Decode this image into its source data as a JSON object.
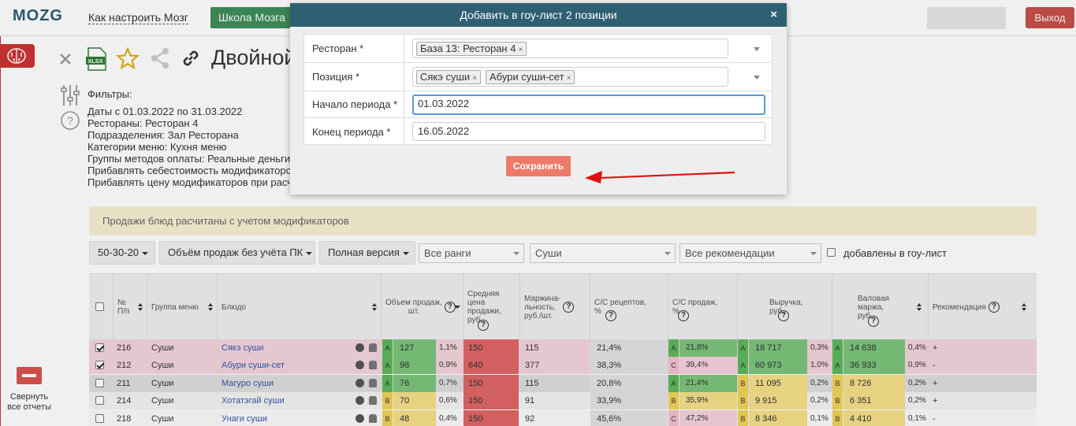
{
  "header": {
    "logo": "MOZG",
    "nav_link": "Как настроить Мозг",
    "school_button": "Школа Мозга",
    "logout": "Выход"
  },
  "sidebar": {
    "collapse_label_1": "Свернуть",
    "collapse_label_2": "все отчеты"
  },
  "toolbar_icons": [
    "close-icon",
    "xlsx-icon",
    "star-icon",
    "share-icon",
    "link-icon"
  ],
  "page_title": "Двойной",
  "filters": {
    "title": "Фильтры:",
    "lines": [
      "Даты с 01.03.2022 по 31.03.2022",
      "Рестораны: Ресторан 4",
      "Подразделения: Зал Ресторана",
      "Категории меню: Кухня меню",
      "Группы методов оплаты: Реальные деньги",
      "Прибавлять себестоимость модификаторов",
      "Прибавлять цену модификаторов при расчёте"
    ]
  },
  "notice": "Продажи блюд расчитаны с учетом модификаторов",
  "filter_bar": {
    "btn_abc": "50-30-20",
    "btn_volume": "Объём продаж без учёта ПК",
    "btn_version": "Полная версия",
    "select_ranks": "Все ранги",
    "select_group": "Суши",
    "select_recs": "Все рекомендации",
    "checkbox_label": "добавлены в гоу-лист"
  },
  "table": {
    "headers": {
      "num": "№\nП/п",
      "group": "Группа меню",
      "dish": "Блюдо",
      "volume": "Объем продаж,\nшт.",
      "avg_price": "Средняя\nцена\nпродажи,\nруб.",
      "margin": "Маржина-\nльность,\nруб./шт.",
      "cs_recipes": "С/С рецептов,\n%",
      "cs_sales": "С/С продаж,\n%",
      "revenue": "Выручка,\nруб.",
      "gross": "Валовая\nмаржа,\nруб.",
      "recommendation": "Рекомендация"
    },
    "rows": [
      {
        "checked": true,
        "num": "216",
        "group": "Суши",
        "dish": "Сякэ суши",
        "vol_rank": "A",
        "vol": "127",
        "vol_pct": "1,1%",
        "price": "150",
        "margin": "115",
        "csr": "21,4%",
        "css_rank": "A",
        "css": "21,8%",
        "rev_rank": "A",
        "rev": "18 717",
        "rev_pct": "0,3%",
        "gm_rank": "A",
        "gm": "14 638",
        "gm_pct": "0,4%",
        "rec": "+"
      },
      {
        "checked": true,
        "num": "212",
        "group": "Суши",
        "dish": "Абури суши-сет",
        "vol_rank": "A",
        "vol": "98",
        "vol_pct": "0,9%",
        "price": "640",
        "margin": "377",
        "csr": "38,3%",
        "css_rank": "C",
        "css": "39,4%",
        "rev_rank": "A",
        "rev": "60 973",
        "rev_pct": "1,0%",
        "gm_rank": "A",
        "gm": "36 933",
        "gm_pct": "0,9%",
        "rec": "-"
      },
      {
        "checked": false,
        "num": "211",
        "group": "Суши",
        "dish": "Магуро суши",
        "vol_rank": "A",
        "vol": "76",
        "vol_pct": "0,7%",
        "price": "150",
        "margin": "115",
        "csr": "20,8%",
        "css_rank": "A",
        "css": "21,4%",
        "rev_rank": "B",
        "rev": "11 095",
        "rev_pct": "0,2%",
        "gm_rank": "B",
        "gm": "8 726",
        "gm_pct": "0,2%",
        "rec": "+"
      },
      {
        "checked": false,
        "num": "214",
        "group": "Суши",
        "dish": "Хотатэгай суши",
        "vol_rank": "B",
        "vol": "70",
        "vol_pct": "0,6%",
        "price": "150",
        "margin": "91",
        "csr": "33,9%",
        "css_rank": "B",
        "css": "35,9%",
        "rev_rank": "B",
        "rev": "9 915",
        "rev_pct": "0,2%",
        "gm_rank": "B",
        "gm": "6 351",
        "gm_pct": "0,2%",
        "rec": "+"
      },
      {
        "checked": false,
        "num": "218",
        "group": "Суши",
        "dish": "Унаги суши",
        "vol_rank": "B",
        "vol": "48",
        "vol_pct": "0,4%",
        "price": "150",
        "margin": "92",
        "csr": "45,6%",
        "css_rank": "C",
        "css": "47,2%",
        "rev_rank": "B",
        "rev": "8 346",
        "rev_pct": "0,1%",
        "gm_rank": "B",
        "gm": "4 410",
        "gm_pct": "0,1%",
        "rec": "-"
      }
    ]
  },
  "modal": {
    "title": "Добавить в гоу-лист 2 позиции",
    "close": "×",
    "restaurant_label": "Ресторан *",
    "restaurant_tags": [
      "База 13: Ресторан 4"
    ],
    "position_label": "Позиция *",
    "position_tags": [
      "Сякэ суши",
      "Абури суши-сет"
    ],
    "tag_remove": "×",
    "start_label": "Начало периода *",
    "start_value": "01.03.2022",
    "end_label": "Конец периода *",
    "end_value": "16.05.2022",
    "save_button": "Сохранить"
  },
  "colors": {
    "modal_header": "#2e5f72",
    "save_button": "#ee7b6a",
    "logout": "#c8504a",
    "school": "#3e8e5a",
    "rank_green": "#5cb85c",
    "rank_yellow": "#f0d35a",
    "rank_pink": "#f2c0cf",
    "price_red": "#e06666"
  }
}
